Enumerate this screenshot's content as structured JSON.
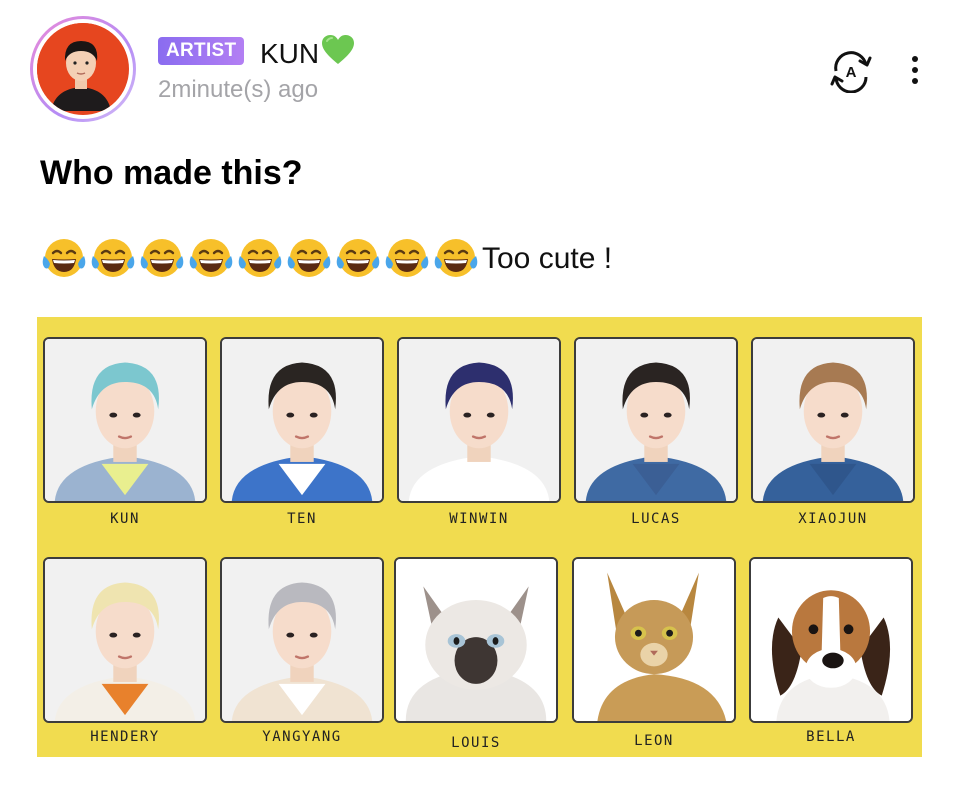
{
  "post": {
    "author": {
      "badge": "ARTIST",
      "name": "KUN",
      "heart": "💚",
      "timestamp": "2minute(s) ago"
    },
    "actions": {
      "translate_icon": "translate-icon",
      "translate_letter": "A",
      "more_icon": "more-vertical-icon"
    },
    "title": "Who made this?",
    "body": {
      "emoji": "face-with-tears-of-joy",
      "emoji_count": 9,
      "text": "Too cute !"
    },
    "image": {
      "background_color": "#f1dc4f",
      "cards": [
        {
          "label": "KUN",
          "kind": "person",
          "hair": "#7cc7cf",
          "shirt": "#e9ef8f",
          "jacket": "#9bb3d0"
        },
        {
          "label": "TEN",
          "kind": "person",
          "hair": "#2a2522",
          "shirt": "#ffffff",
          "jacket": "#3d74c9"
        },
        {
          "label": "WINWIN",
          "kind": "person",
          "hair": "#2d2f6e",
          "shirt": "#ffffff",
          "jacket": "#ffffff"
        },
        {
          "label": "LUCAS",
          "kind": "person",
          "hair": "#2a2422",
          "shirt": "#3b5f95",
          "jacket": "#3f6aa3"
        },
        {
          "label": "XIAOJUN",
          "kind": "person",
          "hair": "#a77a52",
          "shirt": "#2f568c",
          "jacket": "#35619b"
        },
        {
          "label": "HENDERY",
          "kind": "person",
          "hair": "#efe4b0",
          "shirt": "#e8812c",
          "jacket": "#f3efe7"
        },
        {
          "label": "YANGYANG",
          "kind": "person",
          "hair": "#b9b9bf",
          "shirt": "#ffffff",
          "jacket": "#f0e3d2"
        },
        {
          "label": "LOUIS",
          "kind": "siamese-cat"
        },
        {
          "label": "LEON",
          "kind": "abyssinian-cat"
        },
        {
          "label": "BELLA",
          "kind": "beagle-dog"
        }
      ]
    }
  }
}
